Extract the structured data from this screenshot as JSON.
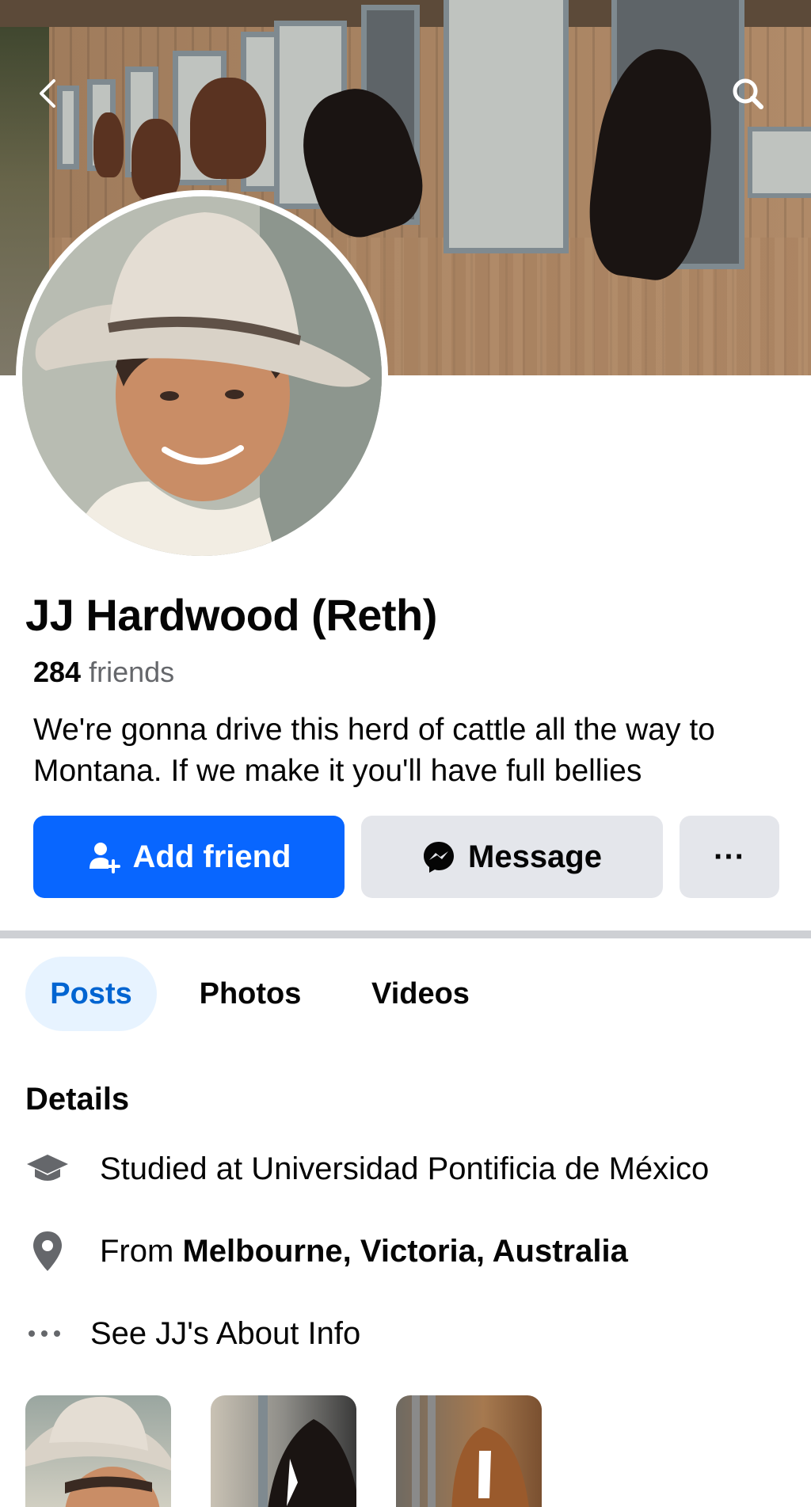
{
  "profile": {
    "name": "JJ Hardwood (Reth)",
    "friends_count": "284",
    "friends_label": "friends",
    "bio": "We're gonna drive this herd of cattle all the way to Montana. If we make it you'll have full bellies"
  },
  "actions": {
    "add_friend": "Add friend",
    "message": "Message",
    "more": "···"
  },
  "tabs": [
    {
      "label": "Posts",
      "selected": true
    },
    {
      "label": "Photos",
      "selected": false
    },
    {
      "label": "Videos",
      "selected": false
    }
  ],
  "details": {
    "title": "Details",
    "studied": "Studied at Universidad Pontificia de México",
    "from_prefix": "From",
    "from_place": "Melbourne, Victoria, Australia",
    "about_link": "See JJ's About Info"
  },
  "icons": {
    "back": "chevron-left-icon",
    "search": "search-icon",
    "add_friend": "person-plus-icon",
    "message": "messenger-icon",
    "education": "graduation-cap-icon",
    "location": "location-pin-icon",
    "more": "ellipsis-icon"
  },
  "colors": {
    "primary": "#0866ff",
    "secondary_button": "#e4e6eb",
    "selected_tab_bg": "#e7f3ff",
    "selected_tab_text": "#0064d1",
    "muted_text": "#65676b"
  }
}
